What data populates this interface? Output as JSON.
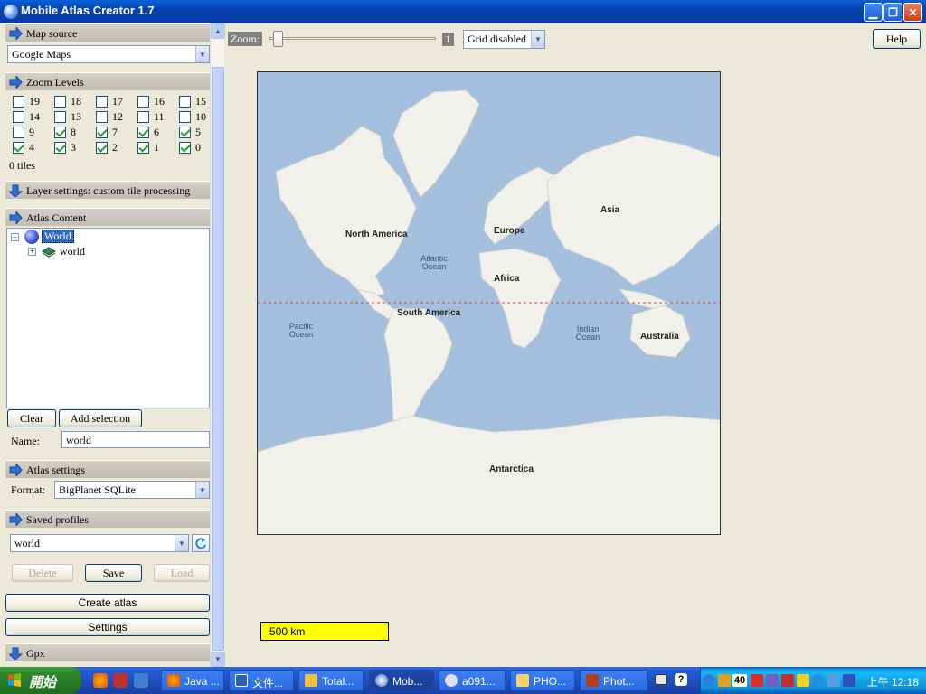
{
  "window": {
    "title": "Mobile Atlas Creator 1.7"
  },
  "map_source": {
    "header": "Map source",
    "value": "Google Maps"
  },
  "zoom_levels": {
    "header": "Zoom Levels",
    "levels": [
      {
        "label": "19",
        "checked": false
      },
      {
        "label": "18",
        "checked": false
      },
      {
        "label": "17",
        "checked": false
      },
      {
        "label": "16",
        "checked": false
      },
      {
        "label": "15",
        "checked": false
      },
      {
        "label": "14",
        "checked": false
      },
      {
        "label": "13",
        "checked": false
      },
      {
        "label": "12",
        "checked": false
      },
      {
        "label": "11",
        "checked": false
      },
      {
        "label": "10",
        "checked": false
      },
      {
        "label": "9",
        "checked": false
      },
      {
        "label": "8",
        "checked": true
      },
      {
        "label": "7",
        "checked": true
      },
      {
        "label": "6",
        "checked": true
      },
      {
        "label": "5",
        "checked": true
      },
      {
        "label": "4",
        "checked": true
      },
      {
        "label": "3",
        "checked": true
      },
      {
        "label": "2",
        "checked": true
      },
      {
        "label": "1",
        "checked": true
      },
      {
        "label": "0",
        "checked": true
      }
    ],
    "tiles": "0 tiles"
  },
  "layer_settings": {
    "header": "Layer settings: custom tile processing"
  },
  "atlas_content": {
    "header": "Atlas Content",
    "root": "World",
    "child": "world",
    "clear_label": "Clear",
    "add_selection_label": "Add selection",
    "name_label": "Name:",
    "name_value": "world"
  },
  "atlas_settings": {
    "header": "Atlas settings",
    "format_label": "Format:",
    "format_value": "BigPlanet SQLite"
  },
  "saved_profiles": {
    "header": "Saved profiles",
    "profile_value": "world",
    "delete_label": "Delete",
    "save_label": "Save",
    "load_label": "Load"
  },
  "actions": {
    "create_atlas": "Create atlas",
    "settings": "Settings"
  },
  "gpx": {
    "header": "Gpx"
  },
  "toolbar": {
    "zoom_label": "Zoom:",
    "zoom_value": "1",
    "grid_value": "Grid disabled",
    "help_label": "Help"
  },
  "map": {
    "continents": [
      "North America",
      "South America",
      "Europe",
      "Africa",
      "Asia",
      "Australia",
      "Antarctica"
    ],
    "oceans": [
      "Atlantic Ocean",
      "Pacific Ocean",
      "Indian Ocean"
    ],
    "scale": "500 km"
  },
  "taskbar": {
    "start_label": "開始",
    "items": [
      "Java ...",
      "文件...",
      "Total...",
      "Mob...",
      "a091...",
      "PHO...",
      "Phot..."
    ],
    "tray_badge": "40",
    "clock": "上午 12:18"
  }
}
